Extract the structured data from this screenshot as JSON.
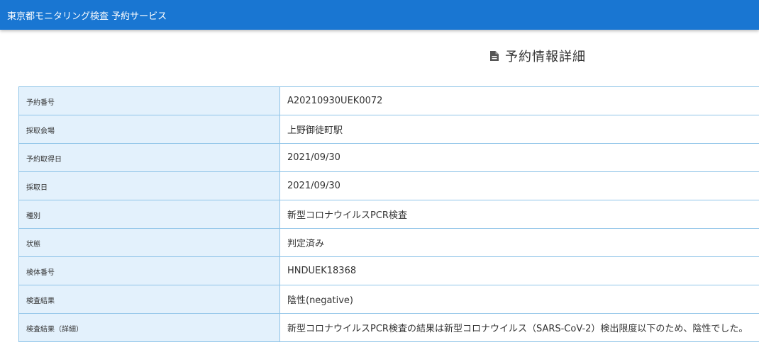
{
  "app": {
    "title": "東京都モニタリング検査 予約サービス",
    "brand_color": "#1976d2"
  },
  "page": {
    "title": "予約情報詳細",
    "title_icon": "document-icon"
  },
  "details": [
    {
      "label": "予約番号",
      "value": "A20210930UEK0072"
    },
    {
      "label": "採取会場",
      "value": "上野御徒町駅"
    },
    {
      "label": "予約取得日",
      "value": "2021/09/30"
    },
    {
      "label": "採取日",
      "value": "2021/09/30"
    },
    {
      "label": "種別",
      "value": "新型コロナウイルスPCR検査"
    },
    {
      "label": "状態",
      "value": "判定済み"
    },
    {
      "label": "検体番号",
      "value": "HNDUEK18368"
    },
    {
      "label": "検査結果",
      "value": "陰性(negative)"
    },
    {
      "label": "検査結果（詳細）",
      "value": "新型コロナウイルスPCR検査の結果は新型コロナウイルス（SARS-CoV-2）検出限度以下のため、陰性でした。"
    }
  ]
}
